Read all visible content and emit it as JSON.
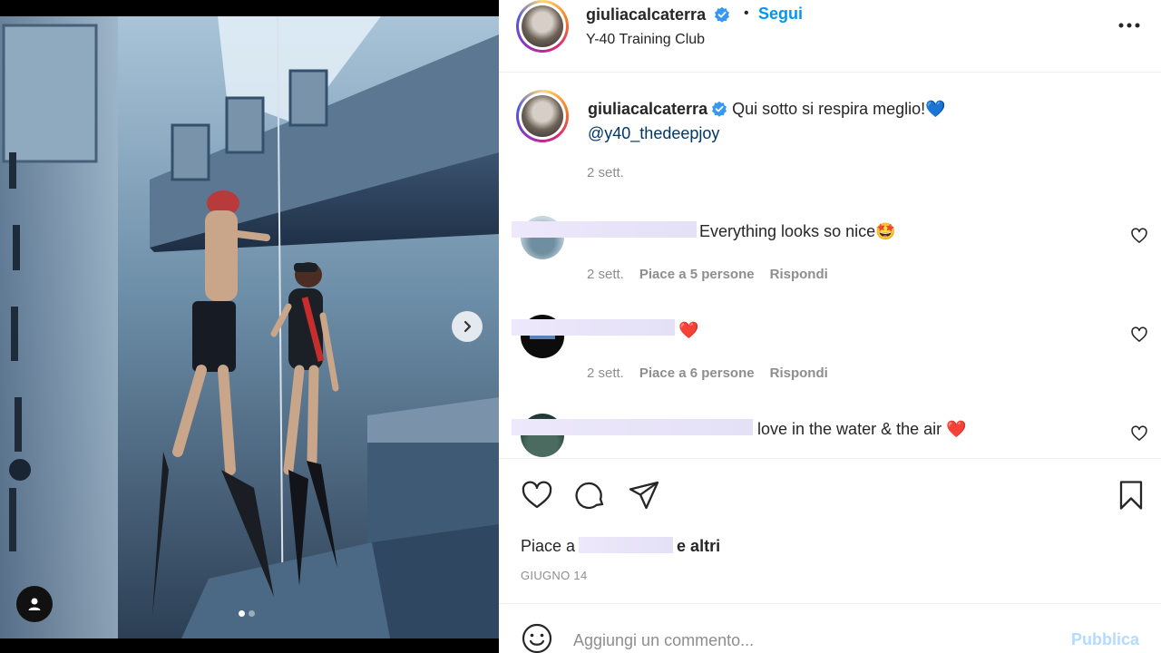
{
  "post": {
    "username": "giuliacalcaterra",
    "follow_label": "Segui",
    "separator": "•",
    "location": "Y-40 Training Club",
    "more_icon": "more-horizontal-icon"
  },
  "caption": {
    "username": "giuliacalcaterra",
    "text": "Qui sotto si respira meglio!",
    "emoji": "💙",
    "mention": "@y40_thedeepjoy",
    "time": "2 sett."
  },
  "comments": [
    {
      "text": "Everything looks so nice🤩",
      "time": "2 sett.",
      "likes": "Piace a 5 persone",
      "reply": "Rispondi"
    },
    {
      "text": "❤️",
      "time": "2 sett.",
      "likes": "Piace a 6 persone",
      "reply": "Rispondi"
    },
    {
      "text": "love in the water & the air ❤️"
    }
  ],
  "likes": {
    "prefix": "Piace a",
    "suffix": "e altri"
  },
  "date": "GIUGNO 14",
  "composer": {
    "placeholder": "Aggiungi un commento...",
    "publish_label": "Pubblica"
  },
  "carousel": {
    "count": 2,
    "active_index": 0
  },
  "colors": {
    "accent": "#0095f6",
    "publish_disabled": "#b3dbff",
    "muted": "#8e8e8e",
    "text": "#262626"
  }
}
